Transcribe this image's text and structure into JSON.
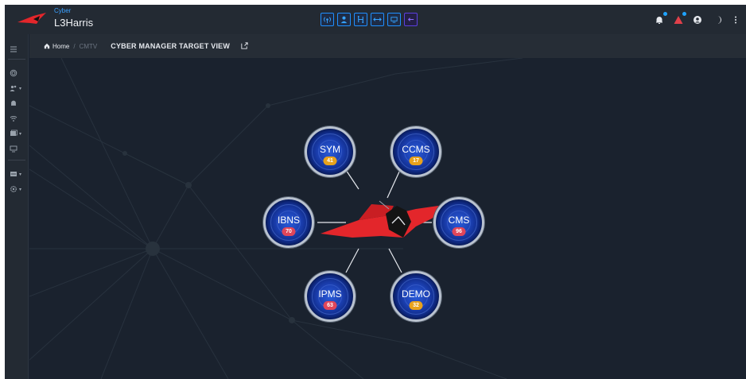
{
  "header": {
    "brand_sub": "Cyber",
    "brand_main": "L3Harris",
    "toolbar": [
      {
        "name": "tool-broadcast",
        "icon": "broadcast-icon"
      },
      {
        "name": "tool-user",
        "icon": "user-icon"
      },
      {
        "name": "tool-network",
        "icon": "network-icon"
      },
      {
        "name": "tool-arrows",
        "icon": "arrows-horizontal-icon"
      },
      {
        "name": "tool-device",
        "icon": "device-icon"
      },
      {
        "name": "tool-back",
        "icon": "arrow-left-icon"
      }
    ],
    "right_icons": [
      "bell-icon",
      "alert-triangle-icon",
      "user-circle-icon",
      "moon-icon",
      "more-vertical-icon"
    ]
  },
  "sidenav": {
    "items": [
      "menu-icon",
      "fingerprint-icon",
      "users-icon",
      "bell-icon",
      "wifi-icon",
      "gallery-icon",
      "monitor-icon",
      "inbox-icon",
      "settings-icon"
    ]
  },
  "breadcrumb": {
    "home": "Home",
    "separator": "/",
    "current": "CMTV",
    "title": "CYBER MANAGER TARGET VIEW"
  },
  "nodes": [
    {
      "id": "sym",
      "label": "SYM",
      "count": "41",
      "badge_color": "#e8a21c"
    },
    {
      "id": "ccms",
      "label": "CCMS",
      "count": "17",
      "badge_color": "#e8a21c"
    },
    {
      "id": "ibns",
      "label": "IBNS",
      "count": "70",
      "badge_color": "#e0465a"
    },
    {
      "id": "cms",
      "label": "CMS",
      "count": "96",
      "badge_color": "#e0465a"
    },
    {
      "id": "ipms",
      "label": "IPMS",
      "count": "63",
      "badge_color": "#e0465a"
    },
    {
      "id": "demo",
      "label": "DEMO",
      "count": "32",
      "badge_color": "#e8a21c"
    }
  ],
  "colors": {
    "accent": "#1f8fff",
    "brand_red": "#e3262b",
    "warning": "#e8a21c",
    "danger": "#e0465a"
  }
}
